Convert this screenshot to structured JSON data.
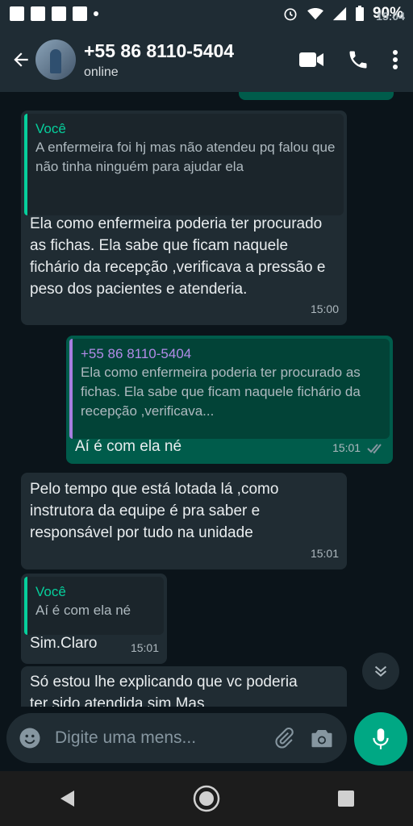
{
  "status_bar": {
    "time": "15:04",
    "battery": "90%"
  },
  "header": {
    "contact_name": "+55 86 8110-5404",
    "status": "online"
  },
  "messages": [
    {
      "direction": "incoming",
      "quote_name": "Você",
      "quote_text": "A enfermeira foi hj mas não atendeu pq falou que não tinha ninguém para ajudar ela",
      "text": "Ela como enfermeira poderia ter procurado as fichas. Ela sabe que ficam naquele fichário da recepção ,verificava a pressão e peso dos pacientes e atenderia.",
      "time": "15:00"
    },
    {
      "direction": "outgoing",
      "quote_name": "+55 86 8110-5404",
      "quote_text": "Ela como enfermeira poderia ter procurado as fichas. Ela sabe que ficam naquele fichário da recepção ,verificava...",
      "text": "Aí é com ela né",
      "time": "15:01",
      "read": true
    },
    {
      "direction": "incoming",
      "text": "Pelo tempo que está lotada lá ,como instrutora da equipe é pra saber e responsável por tudo na unidade",
      "time": "15:01"
    },
    {
      "direction": "incoming",
      "quote_name": "Você",
      "quote_text": "Aí é com ela né",
      "text": "Sim.Claro",
      "time": "15:01"
    },
    {
      "direction": "incoming",
      "text": "Só estou lhe explicando que vc poderia ter sido atendida sim Mas"
    }
  ],
  "input": {
    "placeholder": "Digite uma mens..."
  },
  "colors": {
    "accent": "#00a884",
    "incoming_bubble": "#202c33",
    "outgoing_bubble": "#005c4b"
  },
  "icons": [
    "back-arrow-icon",
    "video-call-icon",
    "phone-icon",
    "more-icon",
    "double-check-icon",
    "chevron-double-down-icon",
    "emoji-icon",
    "attach-icon",
    "camera-icon",
    "mic-icon",
    "nav-back-icon",
    "nav-home-icon",
    "nav-recents-icon"
  ]
}
